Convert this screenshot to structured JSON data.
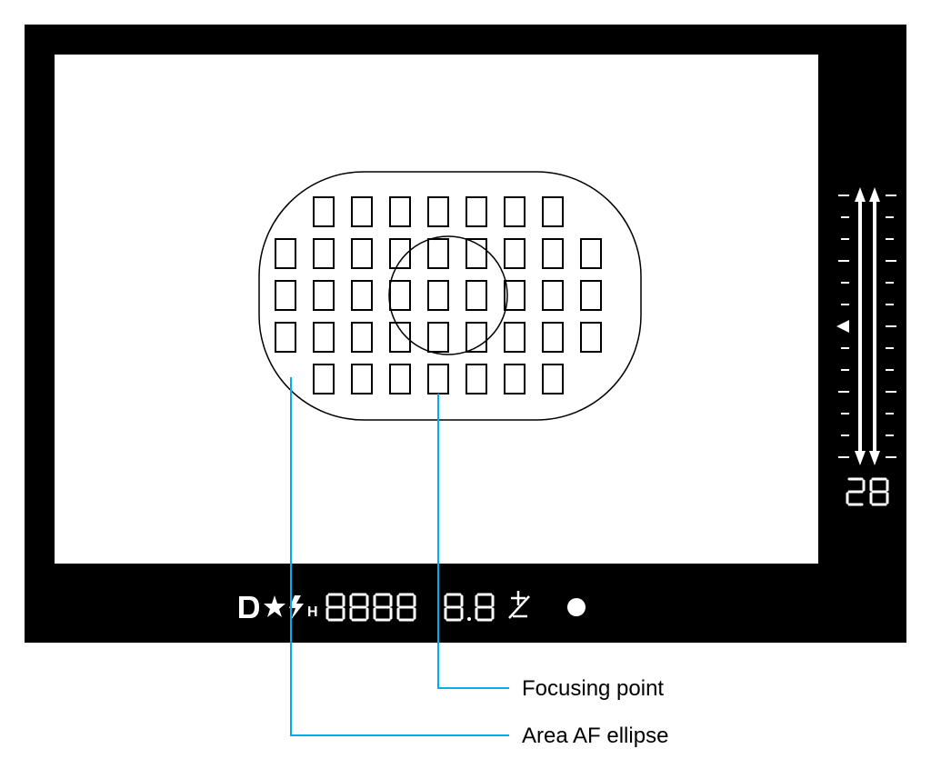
{
  "labels": {
    "focusing_point": "Focusing point",
    "area_af_ellipse": "Area AF ellipse"
  },
  "viewfinder": {
    "shutter_value": "8888",
    "aperture_value": "8.8",
    "side_readout": "28",
    "status_symbols": "D * flash H +/-",
    "af_points": {
      "rows": [
        7,
        9,
        9,
        9,
        7
      ],
      "total": 41
    }
  },
  "callouts": {
    "color": "#00AEEF"
  }
}
